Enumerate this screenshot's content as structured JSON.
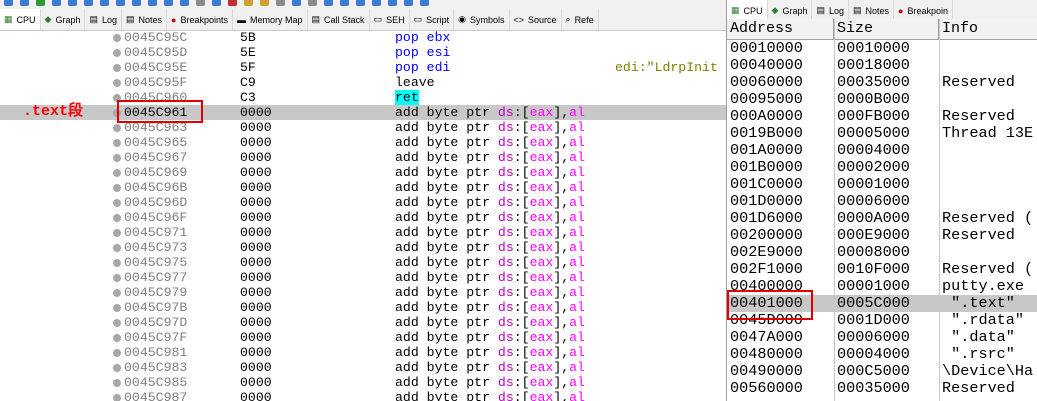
{
  "left_tabs": [
    {
      "icon": "▦",
      "label": "CPU",
      "active": true,
      "name": "tab-cpu"
    },
    {
      "icon": "◆",
      "label": "Graph",
      "name": "tab-graph"
    },
    {
      "icon": "▤",
      "label": "Log",
      "name": "tab-log"
    },
    {
      "icon": "▤",
      "label": "Notes",
      "name": "tab-notes"
    },
    {
      "icon": "●",
      "label": "Breakpoints",
      "name": "tab-breakpoints"
    },
    {
      "icon": "▬",
      "label": "Memory Map",
      "name": "tab-memory-map"
    },
    {
      "icon": "▤",
      "label": "Call Stack",
      "name": "tab-call-stack"
    },
    {
      "icon": "▭",
      "label": "SEH",
      "name": "tab-seh"
    },
    {
      "icon": "▭",
      "label": "Script",
      "name": "tab-script"
    },
    {
      "icon": "◉",
      "label": "Symbols",
      "name": "tab-symbols"
    },
    {
      "icon": "<>",
      "label": "Source",
      "name": "tab-source"
    },
    {
      "icon": "⌕",
      "label": "Refe",
      "name": "tab-references"
    }
  ],
  "disasm": {
    "rows": [
      {
        "addr": "0045C95C",
        "bytes": "5B",
        "mn": "pop",
        "op": "ebx",
        "kind": "stack"
      },
      {
        "addr": "0045C95D",
        "bytes": "5E",
        "mn": "pop",
        "op": "esi",
        "kind": "stack"
      },
      {
        "addr": "0045C95E",
        "bytes": "5F",
        "mn": "pop",
        "op": "edi",
        "kind": "stack",
        "comment": "edi:\"LdrpInit"
      },
      {
        "addr": "0045C95F",
        "bytes": "C9",
        "mn": "leave",
        "op": "",
        "kind": "plain"
      },
      {
        "addr": "0045C960",
        "bytes": "C3",
        "mn": "ret",
        "op": "",
        "kind": "ret"
      },
      {
        "addr": "0045C961",
        "bytes": "0000",
        "mn": "add",
        "kind": "mem",
        "selected": true
      },
      {
        "addr": "0045C963",
        "bytes": "0000",
        "mn": "add",
        "kind": "mem"
      },
      {
        "addr": "0045C965",
        "bytes": "0000",
        "mn": "add",
        "kind": "mem"
      },
      {
        "addr": "0045C967",
        "bytes": "0000",
        "mn": "add",
        "kind": "mem"
      },
      {
        "addr": "0045C969",
        "bytes": "0000",
        "mn": "add",
        "kind": "mem"
      },
      {
        "addr": "0045C96B",
        "bytes": "0000",
        "mn": "add",
        "kind": "mem"
      },
      {
        "addr": "0045C96D",
        "bytes": "0000",
        "mn": "add",
        "kind": "mem"
      },
      {
        "addr": "0045C96F",
        "bytes": "0000",
        "mn": "add",
        "kind": "mem"
      },
      {
        "addr": "0045C971",
        "bytes": "0000",
        "mn": "add",
        "kind": "mem"
      },
      {
        "addr": "0045C973",
        "bytes": "0000",
        "mn": "add",
        "kind": "mem"
      },
      {
        "addr": "0045C975",
        "bytes": "0000",
        "mn": "add",
        "kind": "mem"
      },
      {
        "addr": "0045C977",
        "bytes": "0000",
        "mn": "add",
        "kind": "mem"
      },
      {
        "addr": "0045C979",
        "bytes": "0000",
        "mn": "add",
        "kind": "mem"
      },
      {
        "addr": "0045C97B",
        "bytes": "0000",
        "mn": "add",
        "kind": "mem"
      },
      {
        "addr": "0045C97D",
        "bytes": "0000",
        "mn": "add",
        "kind": "mem"
      },
      {
        "addr": "0045C97F",
        "bytes": "0000",
        "mn": "add",
        "kind": "mem"
      },
      {
        "addr": "0045C981",
        "bytes": "0000",
        "mn": "add",
        "kind": "mem"
      },
      {
        "addr": "0045C983",
        "bytes": "0000",
        "mn": "add",
        "kind": "mem"
      },
      {
        "addr": "0045C985",
        "bytes": "0000",
        "mn": "add",
        "kind": "mem"
      },
      {
        "addr": "0045C987",
        "bytes": "0000",
        "mn": "add",
        "kind": "mem"
      }
    ],
    "mem_operand": {
      "size": "byte ptr",
      "seg": "ds",
      "open": ":[",
      "reg": "eax",
      "mid": "],",
      "reg2": "al"
    }
  },
  "annotation": {
    "label": ".text段"
  },
  "right_tabs": [
    {
      "icon": "▦",
      "label": "CPU",
      "active": true,
      "name": "tab-cpu-2"
    },
    {
      "icon": "◆",
      "label": "Graph",
      "name": "tab-graph-2"
    },
    {
      "icon": "▤",
      "label": "Log",
      "name": "tab-log-2"
    },
    {
      "icon": "▤",
      "label": "Notes",
      "name": "tab-notes-2"
    },
    {
      "icon": "●",
      "label": "Breakpoin",
      "name": "tab-breakpoints-2"
    }
  ],
  "memory_map": {
    "headers": [
      "Address",
      "Size",
      "Info"
    ],
    "rows": [
      {
        "address": "00010000",
        "size": "00010000",
        "info": ""
      },
      {
        "address": "00040000",
        "size": "00018000",
        "info": ""
      },
      {
        "address": "00060000",
        "size": "00035000",
        "info": "Reserved"
      },
      {
        "address": "00095000",
        "size": "0000B000",
        "info": ""
      },
      {
        "address": "000A0000",
        "size": "000FB000",
        "info": "Reserved"
      },
      {
        "address": "0019B000",
        "size": "00005000",
        "info": "Thread 13E"
      },
      {
        "address": "001A0000",
        "size": "00004000",
        "info": ""
      },
      {
        "address": "001B0000",
        "size": "00002000",
        "info": ""
      },
      {
        "address": "001C0000",
        "size": "00001000",
        "info": ""
      },
      {
        "address": "001D0000",
        "size": "00006000",
        "info": ""
      },
      {
        "address": "001D6000",
        "size": "0000A000",
        "info": "Reserved ("
      },
      {
        "address": "00200000",
        "size": "000E9000",
        "info": "Reserved"
      },
      {
        "address": "002E9000",
        "size": "00008000",
        "info": ""
      },
      {
        "address": "002F1000",
        "size": "0010F000",
        "info": "Reserved ("
      },
      {
        "address": "00400000",
        "size": "00001000",
        "info": "putty.exe"
      },
      {
        "address": "00401000",
        "size": "0005C000",
        "info": " \".text\"",
        "selected": true
      },
      {
        "address": "0045D000",
        "size": "0001D000",
        "info": " \".rdata\""
      },
      {
        "address": "0047A000",
        "size": "00006000",
        "info": " \".data\""
      },
      {
        "address": "00480000",
        "size": "00004000",
        "info": " \".rsrc\""
      },
      {
        "address": "00490000",
        "size": "000C5000",
        "info": "\\Device\\Ha"
      },
      {
        "address": "00560000",
        "size": "00035000",
        "info": "Reserved"
      }
    ]
  },
  "colors": {
    "highlight_box": "#e00000",
    "selected_row": "#c8c8c8",
    "mnemonic_blue": "#0000ff",
    "segment": "#c000c0",
    "register": "#ff00ff",
    "comment": "#808000"
  }
}
